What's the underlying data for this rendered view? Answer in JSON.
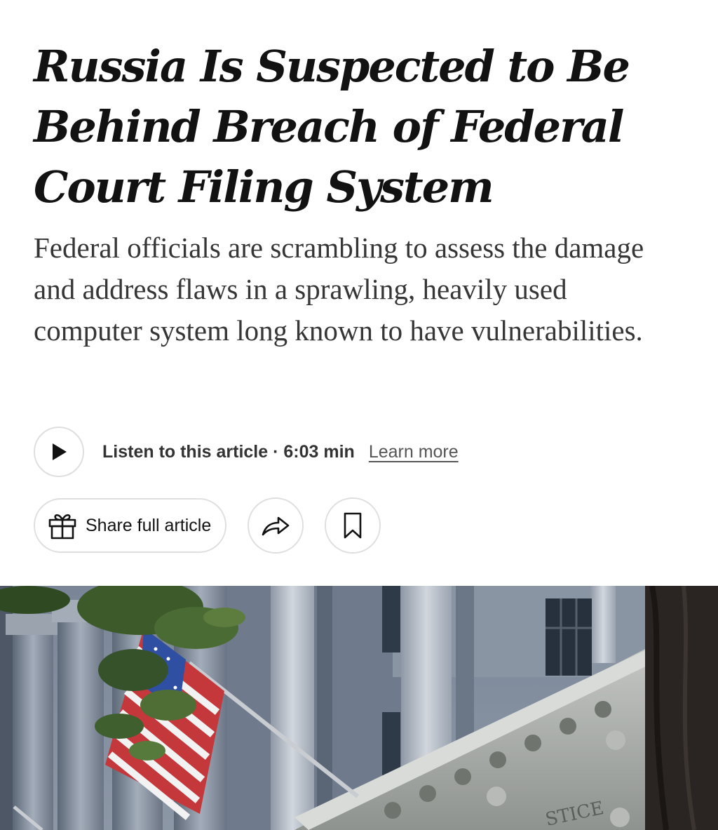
{
  "article": {
    "headline": "Russia Is Suspected to Be Behind Breach of Federal Court Filing System",
    "summary": "Federal officials are scrambling to assess the damage and address flaws in a sprawling, heavily used computer system long known to have vulnerabilities."
  },
  "audio": {
    "listen_label": "Listen to this article · 6:03 min",
    "learn_more_label": "Learn more",
    "icon": "play-icon"
  },
  "actions": {
    "share_full_label": "Share full article",
    "share_full_icon": "gift-icon",
    "share_icon": "share-arrow-icon",
    "save_icon": "bookmark-icon"
  },
  "hero_image": {
    "engraved_text": "STICE"
  },
  "colors": {
    "text_primary": "#121212",
    "text_secondary": "#363636",
    "border": "#dfdfdf"
  }
}
